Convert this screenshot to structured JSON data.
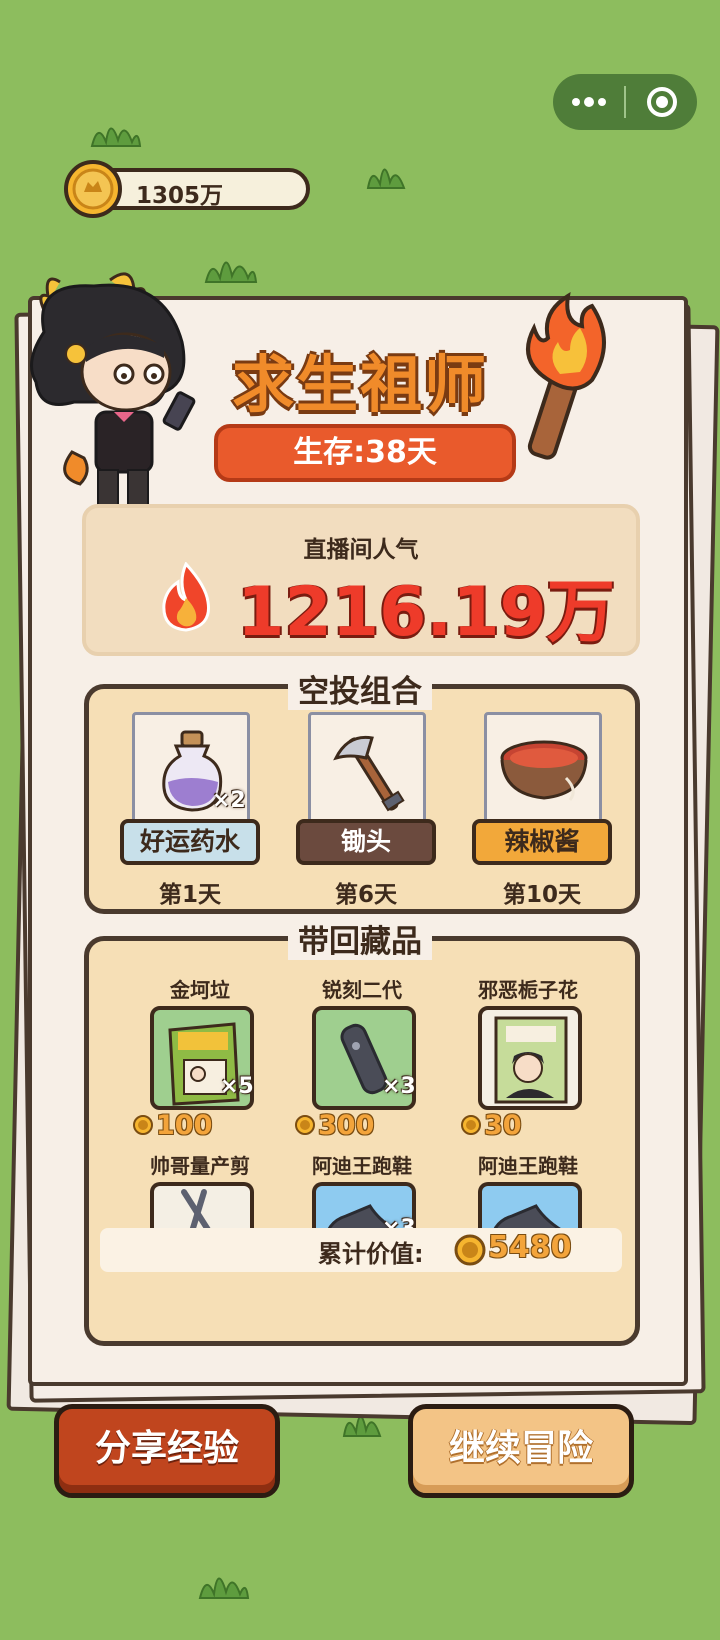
{
  "status": {
    "coins": "1305万"
  },
  "result": {
    "title": "求生祖师",
    "survival": "生存:38天",
    "popularity_label": "直播间人气",
    "popularity_value": "1216.19万"
  },
  "airdrop": {
    "title": "空投组合",
    "items": [
      {
        "name": "好运药水",
        "day": "第1天",
        "qty": "×2",
        "color": "#c8e0ea",
        "text_color": "#3d2a1c",
        "icon": "potion-icon"
      },
      {
        "name": "锄头",
        "day": "第6天",
        "qty": "",
        "color": "#6b4a3e",
        "text_color": "#ffffff",
        "icon": "hoe-icon"
      },
      {
        "name": "辣椒酱",
        "day": "第10天",
        "qty": "",
        "color": "#f2a83a",
        "text_color": "#3d2a1c",
        "icon": "chili-sauce-icon"
      }
    ]
  },
  "collection": {
    "title": "带回藏品",
    "items": [
      {
        "name": "金坷垃",
        "qty": "×5",
        "price": "100",
        "icon": "fertilizer-bag-icon",
        "bg": "#9fcf8f"
      },
      {
        "name": "锐刻二代",
        "qty": "×3",
        "price": "300",
        "icon": "vape-icon",
        "bg": "#9fcf8f"
      },
      {
        "name": "邪恶栀子花",
        "qty": "",
        "price": "30",
        "icon": "book-icon",
        "bg": "#f4efe4"
      },
      {
        "name": "帅哥量产剪",
        "qty": "",
        "price": "",
        "icon": "scissors-icon",
        "bg": "#f4efe4"
      },
      {
        "name": "阿迪王跑鞋",
        "qty": "×3",
        "price": "",
        "icon": "sneaker-icon",
        "bg": "#8ecbf0"
      },
      {
        "name": "阿迪王跑鞋",
        "qty": "",
        "price": "",
        "icon": "sneaker-icon",
        "bg": "#8ecbf0"
      }
    ],
    "total_label": "累计价值:",
    "total_value": "5480"
  },
  "buttons": {
    "share": "分享经验",
    "continue": "继续冒险"
  },
  "colors": {
    "grass": "#8dbd5e",
    "paper": "#f7efe7",
    "accent": "#e95a2c",
    "gold": "#f3a43b"
  }
}
